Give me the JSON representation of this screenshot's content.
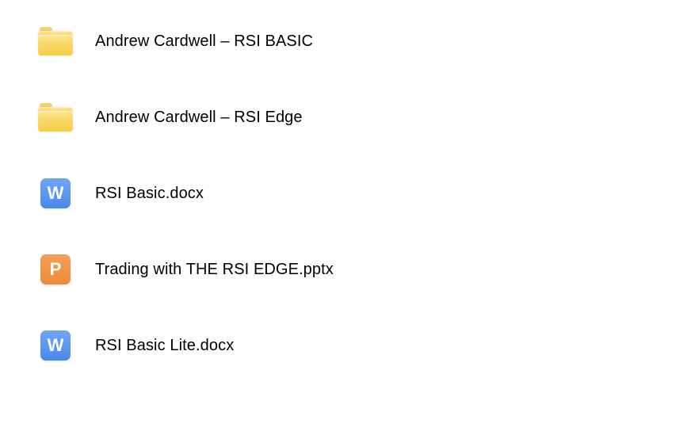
{
  "files": [
    {
      "type": "folder",
      "name": "Andrew Cardwell – RSI BASIC"
    },
    {
      "type": "folder",
      "name": "Andrew Cardwell – RSI Edge"
    },
    {
      "type": "docx",
      "name": "RSI Basic.docx"
    },
    {
      "type": "pptx",
      "name": "Trading with THE RSI EDGE.pptx"
    },
    {
      "type": "docx",
      "name": "RSI Basic Lite.docx"
    }
  ]
}
